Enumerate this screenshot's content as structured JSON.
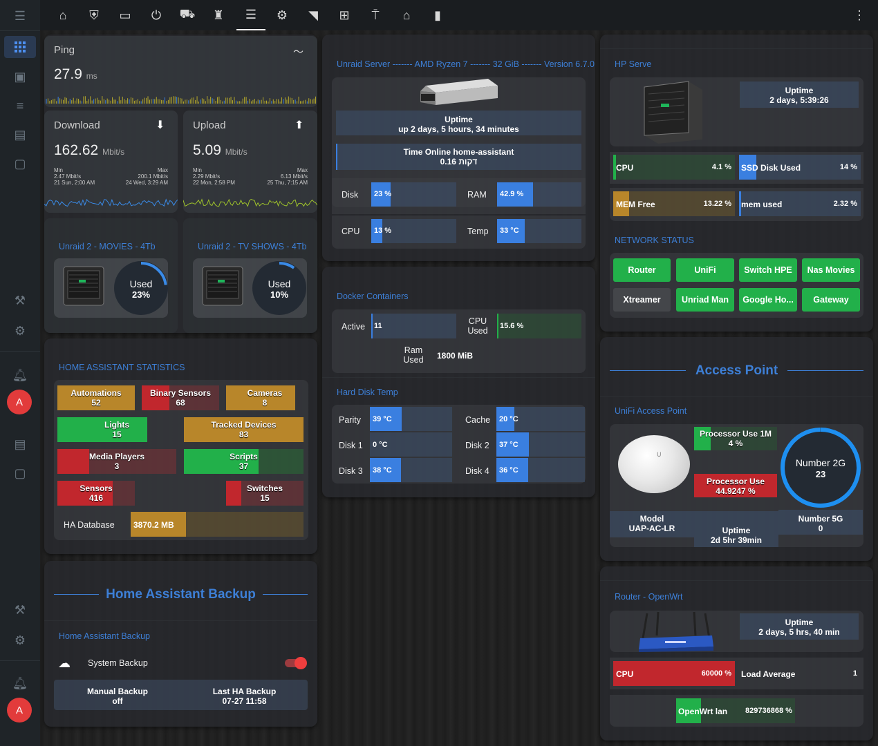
{
  "colors": {
    "accent": "#3d7fd6",
    "green": "#22b04a",
    "red": "#c1272d",
    "gold": "#b8862a",
    "blue": "#3a7fe0"
  },
  "sidebar": {
    "avatar_letter": "A"
  },
  "ping": {
    "title": "Ping",
    "value": "27.9",
    "unit": "ms"
  },
  "download": {
    "title": "Download",
    "value": "162.62",
    "unit": "Mbit/s",
    "min_label": "Min",
    "min_value": "2.47 Mbit/s",
    "min_time": "21 Sun, 2:00 AM",
    "max_label": "Max",
    "max_value": "200.1 Mbit/s",
    "max_time": "24 Wed, 3:29 AM"
  },
  "upload": {
    "title": "Upload",
    "value": "5.09",
    "unit": "Mbit/s",
    "min_label": "Min",
    "min_value": "2.29 Mbit/s",
    "min_time": "22 Mon, 2:58 PM",
    "max_label": "Max",
    "max_value": "6.13 Mbit/s",
    "max_time": "25 Thu, 7:15 AM"
  },
  "movies": {
    "title": "Unraid 2 - MOVIES - 4Tb",
    "label": "Used",
    "value": "23%",
    "percent": 23
  },
  "tvshows": {
    "title": "Unraid 2 - TV SHOWS - 4Tb",
    "label": "Used",
    "value": "10%",
    "percent": 10
  },
  "ha_stats": {
    "title": "HOME ASSISTANT STATISTICS",
    "automations": {
      "label": "Automations",
      "value": "52"
    },
    "binary": {
      "label": "Binary Sensors",
      "value": "68"
    },
    "cameras": {
      "label": "Cameras",
      "value": "8"
    },
    "lights": {
      "label": "Lights",
      "value": "15"
    },
    "tracked": {
      "label": "Tracked Devices",
      "value": "83"
    },
    "media": {
      "label": "Media Players",
      "value": "3"
    },
    "scripts": {
      "label": "Scripts",
      "value": "37"
    },
    "sensors": {
      "label": "Sensors",
      "value": "416"
    },
    "switches": {
      "label": "Switches",
      "value": "15"
    },
    "db_label": "HA Database",
    "db_value": "3870.2 MB"
  },
  "backup": {
    "heading": "Home Assistant Backup",
    "subtitle": "Home Assistant Backup",
    "system_label": "System Backup",
    "manual_label": "Manual Backup",
    "manual_value": "off",
    "last_label": "Last HA Backup",
    "last_value": "07-27 11:58"
  },
  "unraid": {
    "title": "Unraid Server ------- AMD Ryzen 7 ------- 32 GiB ------- Version 6.7.0",
    "uptime_label": "Uptime",
    "uptime_value": "up 2 days, 5 hours, 34 minutes",
    "online_label": "Time Online home-assistant",
    "online_value": "0.16 דקות",
    "disk_label": "Disk",
    "disk_value": "23 %",
    "disk_pct": 23,
    "ram_label": "RAM",
    "ram_value": "42.9 %",
    "ram_pct": 42.9,
    "cpu_label": "CPU",
    "cpu_value": "13 %",
    "cpu_pct": 13,
    "temp_label": "Temp",
    "temp_value": "33 °C",
    "temp_pct": 33
  },
  "docker": {
    "title": "Docker Containers",
    "active_label": "Active",
    "active_value": "11",
    "cpu_label": "CPU Used",
    "cpu_value": "15.6 %",
    "ram_label": "Ram Used",
    "ram_value": "1800 MiB"
  },
  "hdd": {
    "title": "Hard Disk Temp",
    "parity_label": "Parity",
    "parity_value": "39 °C",
    "parity_pct": 39,
    "cache_label": "Cache",
    "cache_value": "20 °C",
    "cache_pct": 20,
    "disk1_label": "Disk 1",
    "disk1_value": "0 °C",
    "disk1_pct": 0,
    "disk2_label": "Disk 2",
    "disk2_value": "37 °C",
    "disk2_pct": 37,
    "disk3_label": "Disk 3",
    "disk3_value": "38 °C",
    "disk3_pct": 38,
    "disk4_label": "Disk 4",
    "disk4_value": "36 °C",
    "disk4_pct": 36
  },
  "hp": {
    "title": "HP Serve",
    "uptime_label": "Uptime",
    "uptime_value": "2 days, 5:39:26",
    "cpu_label": "CPU",
    "cpu_value": "4.1 %",
    "ssd_label": "SSD Disk Used",
    "ssd_value": "14 %",
    "mem_label": "MEM Free",
    "mem_value": "13.22 %",
    "memused_label": "mem used",
    "memused_value": "2.32 %"
  },
  "network": {
    "title": "NETWORK STATUS",
    "buttons": [
      "Router",
      "UniFi",
      "Switch HPE",
      "Nas Movies",
      "Xtreamer",
      "Unriad Man",
      "Google Ho...",
      "Gateway"
    ]
  },
  "ap": {
    "heading": "Access Point",
    "subtitle": "UniFi Access Point",
    "proc1_label": "Processor Use 1M",
    "proc1_value": "4 %",
    "proc2_label": "Processor Use",
    "proc2_value": "44.9247 %",
    "model_label": "Model",
    "model_value": "UAP-AC-LR",
    "uptime_label": "Uptime",
    "uptime_value": "2d 5hr 39min",
    "n2g_label": "Number 2G",
    "n2g_value": "23",
    "n5g_label": "Number 5G",
    "n5g_value": "0"
  },
  "router": {
    "title": "Router - OpenWrt",
    "uptime_label": "Uptime",
    "uptime_value": "2 days, 5 hrs, 40 min",
    "cpu_label": "CPU",
    "cpu_value": "60000 %",
    "load_label": "Load Average",
    "load_value": "1",
    "lan_label": "OpenWrt lan",
    "lan_value": "829736868 %"
  }
}
